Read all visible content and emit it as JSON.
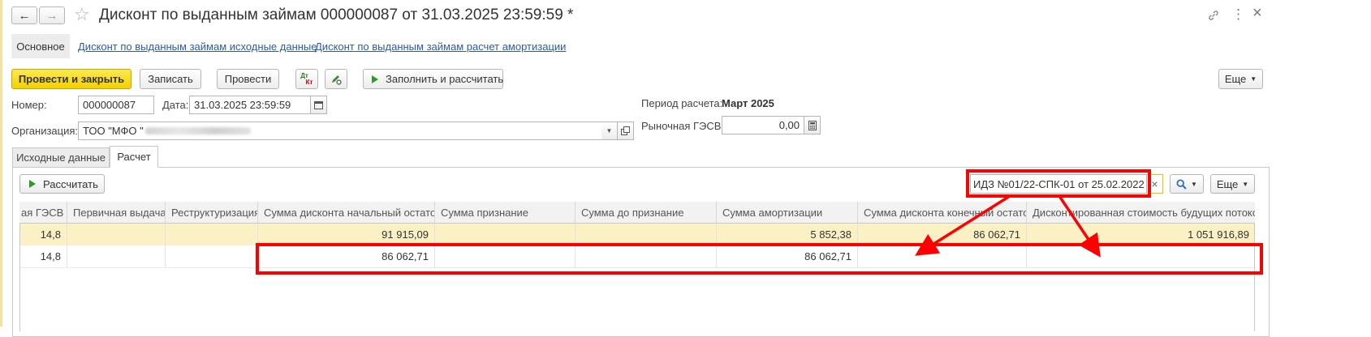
{
  "window": {
    "title": "Дисконт по выданным займам 000000087 от 31.03.2025 23:59:59 *",
    "nav_back": "←",
    "nav_forward": "→",
    "star": "☆",
    "link_icon": "🔗",
    "menu": "⋮",
    "close": "×"
  },
  "sections": {
    "main": "Основное",
    "link1": "Дисконт по выданным займам исходные данные",
    "link2": "Дисконт по выданным займам расчет амортизации"
  },
  "toolbar": {
    "post_close": "Провести и закрыть",
    "save": "Записать",
    "post": "Провести",
    "dtkt_top": "Дт",
    "dtkt_bottom": "Кт",
    "fill_calc": "Заполнить и рассчитать",
    "more": "Еще"
  },
  "header": {
    "number_label": "Номер:",
    "number_value": "000000087",
    "date_label": "Дата:",
    "date_value": "31.03.2025 23:59:59",
    "org_label": "Организация:",
    "org_value": "ТОО \"МФО \"",
    "period_label": "Период расчета:",
    "period_value": "Март 2025",
    "market_label": "Рыночная ГЭСВ:",
    "market_value": "0,00"
  },
  "tabs": {
    "source": "Исходные данные",
    "calc": "Расчет"
  },
  "calc_panel": {
    "calc_button": "Рассчитать",
    "filter_value": "ИДЗ №01/22-СПК-01  от 25.02.2022",
    "clear": "×",
    "more": "Еще"
  },
  "grid": {
    "columns": [
      "ая ГЭСВ",
      "Первичная выдача",
      "Реструктуризация",
      "Сумма дисконта начальный остаток",
      "Сумма признание",
      "Сумма до признание",
      "Сумма амортизации",
      "Сумма дисконта конечный остаток",
      "Дисконтированная стоимость будущих потоков"
    ],
    "rows": [
      [
        "14,8",
        "",
        "",
        "91 915,09",
        "",
        "",
        "5 852,38",
        "86 062,71",
        "1 051 916,89"
      ],
      [
        "14,8",
        "",
        "",
        "86 062,71",
        "",
        "",
        "86 062,71",
        "",
        ""
      ]
    ]
  },
  "colors": {
    "accent_yellow": "#f3d000",
    "selected_row": "#fcf1c4",
    "annotation_red": "#ff0000",
    "link_blue": "#2a5bb3"
  }
}
